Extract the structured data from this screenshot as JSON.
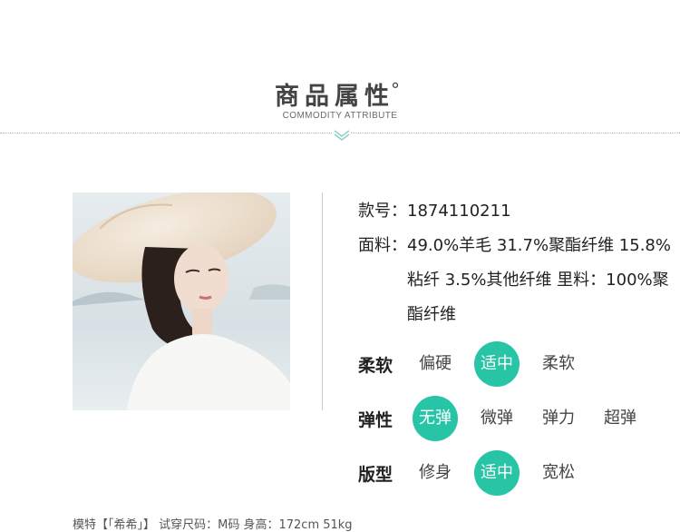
{
  "header": {
    "title": "商品属性",
    "degree": "°",
    "subtitle": "COMMODITY ATTRIBUTE"
  },
  "product": {
    "style_label": "款号：",
    "style_value": "1874110211",
    "fabric_label": "面料：",
    "fabric_value": "49.0%羊毛 31.7%聚酯纤维 15.8%粘纤 3.5%其他纤维 里料：100%聚酯纤维"
  },
  "attributes": {
    "softness": {
      "name": "柔软",
      "options": [
        "偏硬",
        "适中",
        "柔软"
      ],
      "selected": "适中"
    },
    "elasticity": {
      "name": "弹性",
      "options": [
        "无弹",
        "微弹",
        "弹力",
        "超弹"
      ],
      "selected": "无弹"
    },
    "fit": {
      "name": "版型",
      "options": [
        "修身",
        "适中",
        "宽松"
      ],
      "selected": "适中"
    }
  },
  "footer": {
    "model_text": "模特【「希希」】 试穿尺码：M码 身高：172cm 51kg"
  },
  "colors": {
    "accent": "#27c4a6",
    "chevron": "#8ecfc2",
    "hat": "#efe3d2",
    "sky": "#dde6ea"
  }
}
